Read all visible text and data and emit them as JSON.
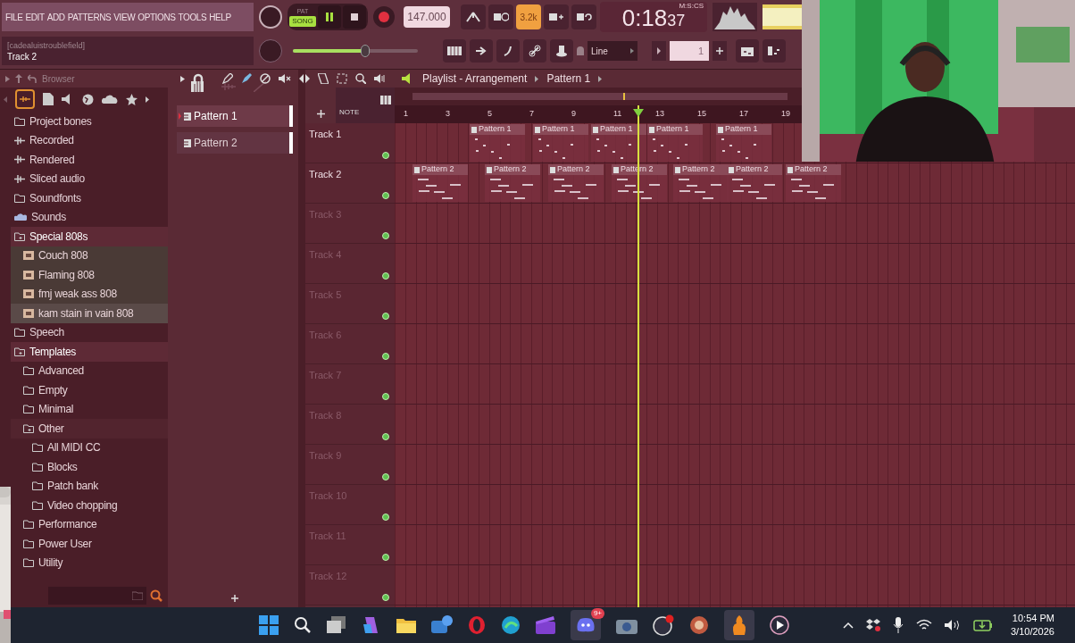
{
  "menu": [
    "FILE",
    "EDIT",
    "ADD",
    "PATTERNS",
    "VIEW",
    "OPTIONS",
    "TOOLS",
    "HELP"
  ],
  "transport": {
    "pat_label": "PAT",
    "song_label": "SONG",
    "song_selected": true,
    "playing": true,
    "tempo": "147.000",
    "snap_readout": "3.2k",
    "snap_readout_on": true,
    "time_main": "0:18",
    "time_cs": "37",
    "time_format": "M:S:CS"
  },
  "hint": {
    "title": "[cadealuistroublefield]",
    "text": "Track 2"
  },
  "master_volume": {
    "level": 0.58
  },
  "snap": {
    "value": "Line"
  },
  "pattern_number": "1",
  "browser": {
    "title": "Browser",
    "tree": [
      {
        "name": "Project bones",
        "kind": "folder",
        "expanded": false
      },
      {
        "name": "Recorded",
        "kind": "audio",
        "expanded": false
      },
      {
        "name": "Rendered",
        "kind": "audio",
        "expanded": false
      },
      {
        "name": "Sliced audio",
        "kind": "audio",
        "expanded": false
      },
      {
        "name": "Soundfonts",
        "kind": "folder",
        "expanded": false
      },
      {
        "name": "Sounds",
        "kind": "cloud",
        "expanded": false
      },
      {
        "name": "Special 808s",
        "kind": "folder",
        "expanded": true,
        "children": [
          {
            "name": "Couch 808",
            "kind": "file",
            "selected": false
          },
          {
            "name": "Flaming 808",
            "kind": "file",
            "selected": false
          },
          {
            "name": "fmj weak ass 808",
            "kind": "file",
            "selected": false
          },
          {
            "name": "kam stain in vain 808",
            "kind": "file",
            "selected": true
          }
        ]
      },
      {
        "name": "Speech",
        "kind": "folder",
        "expanded": false
      },
      {
        "name": "Templates",
        "kind": "folder",
        "expanded": true,
        "children": [
          {
            "name": "Advanced",
            "kind": "folder",
            "expanded": false
          },
          {
            "name": "Empty",
            "kind": "folder",
            "expanded": false
          },
          {
            "name": "Minimal",
            "kind": "folder",
            "expanded": false
          },
          {
            "name": "Other",
            "kind": "folder",
            "expanded": true,
            "children": [
              {
                "name": "All MIDI CC",
                "kind": "folder",
                "expanded": false
              },
              {
                "name": "Blocks",
                "kind": "folder",
                "expanded": false
              },
              {
                "name": "Patch bank",
                "kind": "folder",
                "expanded": false
              },
              {
                "name": "Video chopping",
                "kind": "folder",
                "expanded": false
              }
            ]
          },
          {
            "name": "Performance",
            "kind": "folder",
            "expanded": false
          },
          {
            "name": "Power User",
            "kind": "folder",
            "expanded": false
          },
          {
            "name": "Utility",
            "kind": "folder",
            "expanded": false
          }
        ]
      }
    ]
  },
  "channels": [
    {
      "name": "Pattern 1",
      "selected": true
    },
    {
      "name": "Pattern 2",
      "selected": false
    }
  ],
  "playlist": {
    "title": "Playlist - Arrangement",
    "pattern": "Pattern 1",
    "column_label": "NOTE",
    "ruler": [
      "1",
      "3",
      "5",
      "7",
      "9",
      "11",
      "13",
      "15",
      "17",
      "19"
    ],
    "tracks": [
      {
        "name": "Track 1",
        "clips": [
          "Pattern 1",
          "Pattern 1",
          "Pattern 1",
          "Pattern 1",
          "Pattern 1"
        ]
      },
      {
        "name": "Track 2",
        "clips": [
          "Pattern 2",
          "Pattern 2",
          "Pattern 2",
          "Pattern 2",
          "Pattern 2",
          "Pattern 2",
          "Pattern 2"
        ]
      },
      {
        "name": "Track 3"
      },
      {
        "name": "Track 4"
      },
      {
        "name": "Track 5"
      },
      {
        "name": "Track 6"
      },
      {
        "name": "Track 7"
      },
      {
        "name": "Track 8"
      },
      {
        "name": "Track 9"
      },
      {
        "name": "Track 10"
      },
      {
        "name": "Track 11"
      },
      {
        "name": "Track 12"
      }
    ]
  },
  "taskbar": {
    "badge": "9+",
    "time": "10:54 PM",
    "date": "3/10/2026"
  }
}
